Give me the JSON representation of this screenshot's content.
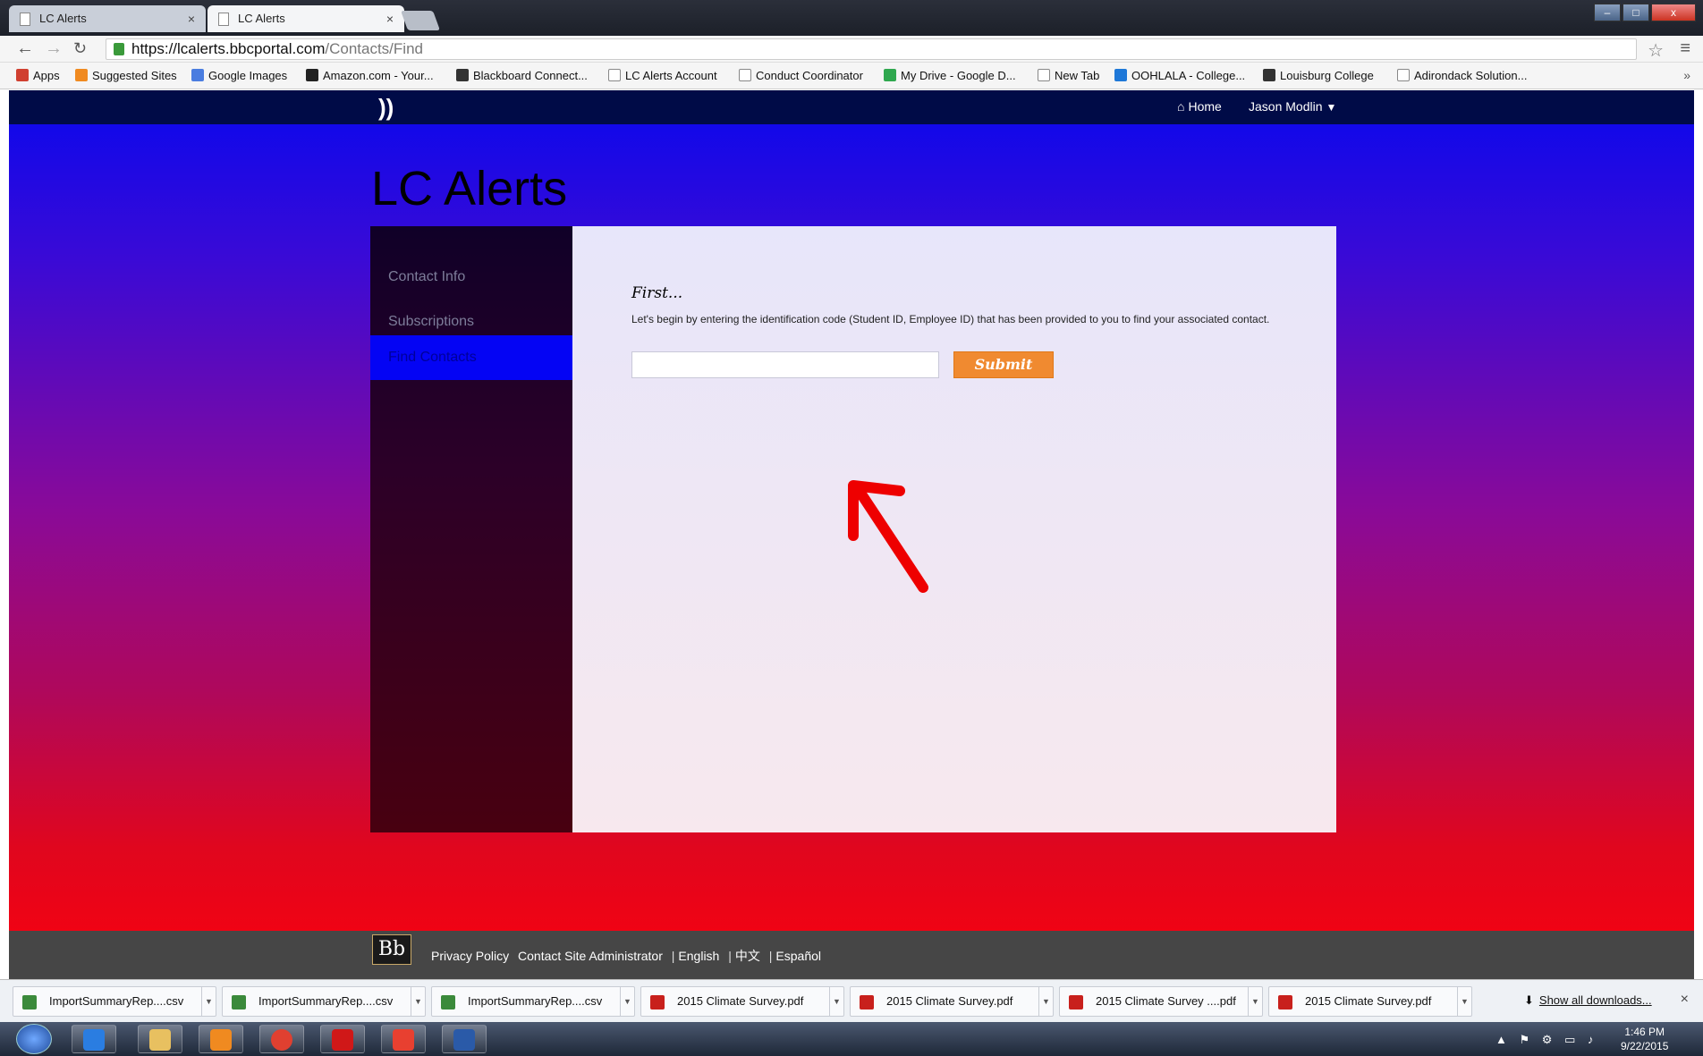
{
  "browser": {
    "tabs": [
      {
        "label": "LC Alerts",
        "active": false
      },
      {
        "label": "LC Alerts",
        "active": true
      }
    ],
    "url": {
      "host": "https://lcalerts.bbcportal.com",
      "path": "/Contacts/Find"
    },
    "bookmarks": [
      {
        "label": "Apps",
        "icon": "apps-grid-icon",
        "color": "#d04030"
      },
      {
        "label": "Suggested Sites",
        "icon": "suggested-sites-icon",
        "color": "#f08a20"
      },
      {
        "label": "Google Images",
        "icon": "google-icon",
        "color": "#4a7de0"
      },
      {
        "label": "Amazon.com - Your...",
        "icon": "amazon-icon",
        "color": "#222222"
      },
      {
        "label": "Blackboard Connect...",
        "icon": "blackboard-icon",
        "color": "#333333"
      },
      {
        "label": "LC Alerts Account",
        "icon": "page-icon",
        "color": "#ffffff"
      },
      {
        "label": "Conduct Coordinator",
        "icon": "page-icon",
        "color": "#ffffff"
      },
      {
        "label": "My Drive - Google D...",
        "icon": "drive-icon",
        "color": "#2fa84f"
      },
      {
        "label": "New Tab",
        "icon": "page-icon",
        "color": "#ffffff"
      },
      {
        "label": "OOHLALA - College...",
        "icon": "oohlala-icon",
        "color": "#1e78d8"
      },
      {
        "label": "Louisburg College",
        "icon": "college-icon",
        "color": "#333333"
      },
      {
        "label": "Adirondack Solution...",
        "icon": "page-icon",
        "color": "#ffffff"
      }
    ]
  },
  "site": {
    "logo": "))",
    "home_label": "Home",
    "user_label": "Jason Modlin",
    "title": "LC Alerts",
    "sidenav": [
      {
        "label": "Contact Info",
        "active": false
      },
      {
        "label": "Subscriptions",
        "active": false
      },
      {
        "label": "Find Contacts",
        "active": true
      }
    ],
    "form": {
      "heading": "First...",
      "description": "Let's begin by entering the identification code (Student ID, Employee ID) that has been provided to you to find your associated contact.",
      "input_value": "",
      "submit_label": "Submit"
    },
    "footer": {
      "bb_logo": "Bb",
      "links": [
        "Privacy Policy",
        "Contact Site Administrator",
        "English",
        "中文",
        "Español"
      ]
    },
    "colors": {
      "accent": "#f08a30",
      "nav_active": "#0404f4",
      "topbar": "#000b47",
      "annotation_arrow": "#ee0000"
    }
  },
  "downloads": {
    "items": [
      {
        "label": "ImportSummaryRep....csv",
        "icon": "csv-file-icon",
        "color": "#3b8a3b"
      },
      {
        "label": "ImportSummaryRep....csv",
        "icon": "csv-file-icon",
        "color": "#3b8a3b"
      },
      {
        "label": "ImportSummaryRep....csv",
        "icon": "csv-file-icon",
        "color": "#3b8a3b"
      },
      {
        "label": "2015 Climate Survey.pdf",
        "icon": "pdf-file-icon",
        "color": "#c8201c"
      },
      {
        "label": "2015 Climate Survey.pdf",
        "icon": "pdf-file-icon",
        "color": "#c8201c"
      },
      {
        "label": "2015 Climate Survey ....pdf",
        "icon": "pdf-file-icon",
        "color": "#c8201c"
      },
      {
        "label": "2015 Climate Survey.pdf",
        "icon": "pdf-file-icon",
        "color": "#c8201c"
      }
    ],
    "show_all": "Show all downloads..."
  },
  "taskbar": {
    "apps": [
      {
        "name": "internet-explorer-icon",
        "color": "#2a7de1"
      },
      {
        "name": "file-explorer-icon",
        "color": "#e8c060"
      },
      {
        "name": "media-player-icon",
        "color": "#f08a20"
      },
      {
        "name": "chrome-icon",
        "color": "#e04030"
      },
      {
        "name": "acrobat-icon",
        "color": "#d01818"
      },
      {
        "name": "gmail-icon",
        "color": "#e84030"
      },
      {
        "name": "word-icon",
        "color": "#2a5aa8"
      }
    ],
    "clock_time": "1:46 PM",
    "clock_date": "9/22/2015"
  }
}
